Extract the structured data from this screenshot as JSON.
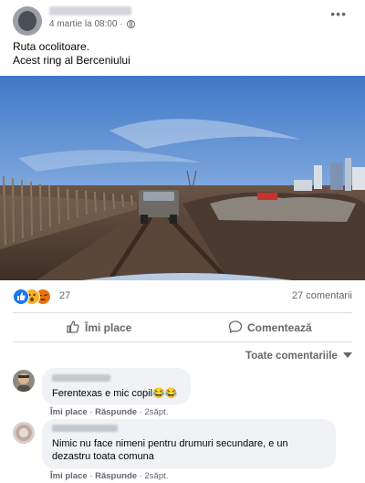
{
  "post": {
    "date": "4 martie la 08:00",
    "more": "•••",
    "text_line1": "Ruta ocolitoare.",
    "text_line2": "Acest ring al Berceniului"
  },
  "stats": {
    "reaction_count": "27",
    "comment_count": "27 comentarii"
  },
  "actions": {
    "like": "Îmi place",
    "comment": "Comentează"
  },
  "comments_sort": "Toate comentariile",
  "comments": [
    {
      "text": "Ferentexas e mic copil😂😂",
      "like": "Îmi place",
      "reply": "Răspunde",
      "time": "2săpt."
    },
    {
      "text_line1": "Nimic nu face nimeni pentru drumuri secundare, e un",
      "text_line2": "dezastru toata comuna",
      "like": "Îmi place",
      "reply": "Răspunde",
      "time": "2săpt."
    }
  ],
  "colors": {
    "like_blue": "#1877f2",
    "secondary_text": "#65676b",
    "bubble_bg": "#f0f2f5"
  },
  "icons": [
    "globe-icon",
    "more-icon",
    "thumbs-up-icon",
    "comment-icon",
    "caret-down-icon",
    "like-reaction-icon",
    "wow-reaction-icon",
    "angry-reaction-icon"
  ]
}
